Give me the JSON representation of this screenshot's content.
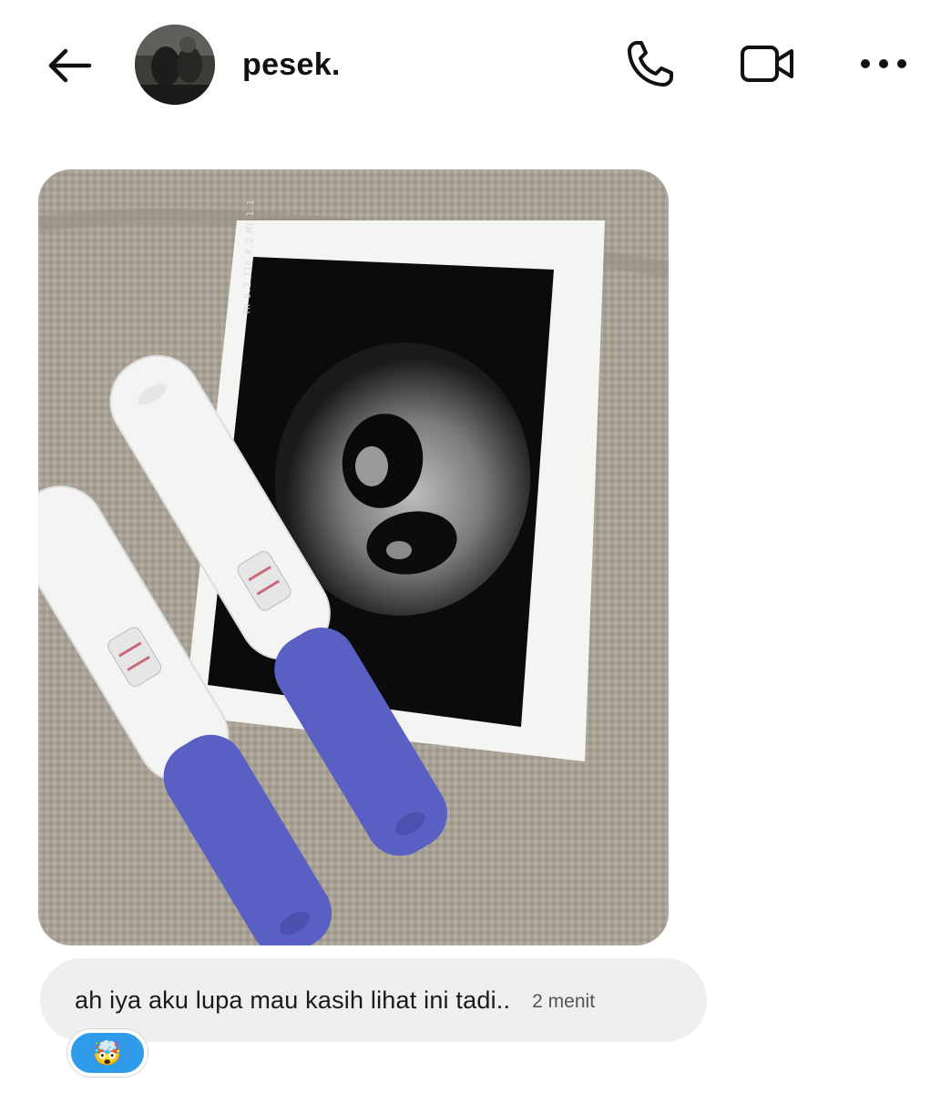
{
  "header": {
    "contact_name": "pesek.",
    "back_icon": "arrow-left-icon",
    "call_icon": "phone-icon",
    "video_icon": "video-camera-icon",
    "more_icon": "more-horizontal-icon"
  },
  "messages": [
    {
      "type": "photo",
      "description_icon": "photo-attachment"
    },
    {
      "type": "text",
      "text": "ah iya aku lupa mau kasih lihat ini tadi..",
      "time": "2 menit",
      "reaction": "🤯"
    }
  ],
  "colors": {
    "bubble_bg": "#efeff0",
    "reaction_bg": "#2f9be9",
    "test_handle": "#5a5fc4"
  }
}
